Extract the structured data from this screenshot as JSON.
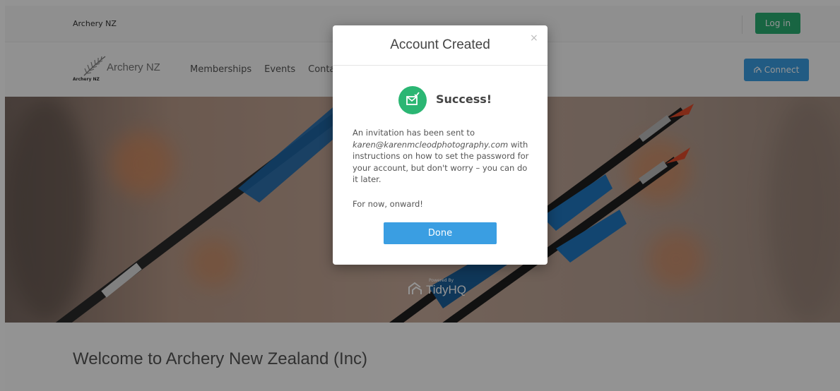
{
  "topbar": {
    "org_name": "Archery NZ",
    "login_label": "Log in"
  },
  "navbar": {
    "logo_small_text": "Archery NZ",
    "logo_name": "Archery NZ",
    "links": [
      "Memberships",
      "Events",
      "Conta"
    ],
    "connect_label": "Connect"
  },
  "hero": {
    "powered_by": "Powered By",
    "brand": "TidyHQ"
  },
  "welcome": "Welcome to Archery New Zealand (Inc)",
  "modal": {
    "title": "Account Created",
    "close_symbol": "×",
    "success": "Success!",
    "message_prefix": "An invitation has been sent to ",
    "email": "karen@karenmcleodphotography.com",
    "message_suffix": " with instructions on how to set the password for your account, but don't worry – you can do it later.",
    "message2": "For now, onward!",
    "done_label": "Done"
  },
  "colors": {
    "login_green": "#2aae73",
    "connect_blue": "#3a9ee2",
    "success_green": "#2bb673",
    "done_blue": "#3a9ee2"
  }
}
